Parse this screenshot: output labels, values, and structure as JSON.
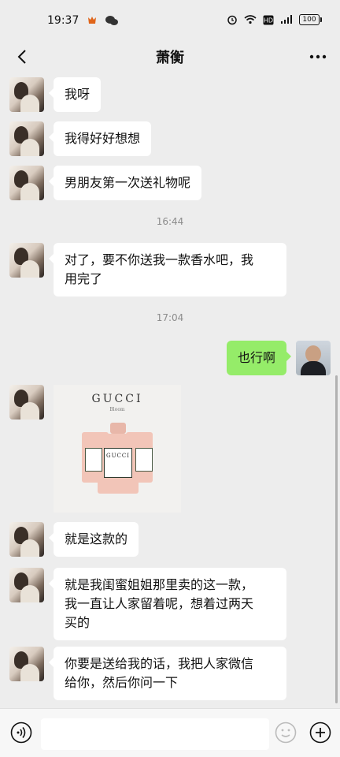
{
  "status_bar": {
    "time": "19:37",
    "network_icons": [
      "hd-icon",
      "4g-icon",
      "wifi-icon"
    ],
    "battery": "100"
  },
  "header": {
    "title": "萧衡"
  },
  "messages": [
    {
      "from": "other",
      "text": "我呀"
    },
    {
      "from": "other",
      "text": "我得好好想想"
    },
    {
      "from": "other",
      "text": "男朋友第一次送礼物呢"
    },
    {
      "type": "time",
      "text": "16:44"
    },
    {
      "from": "other",
      "text_lines": [
        "对了，要不你送我一款香水吧，我",
        "用完了"
      ]
    },
    {
      "type": "time",
      "text": "17:04"
    },
    {
      "from": "me",
      "text": "也行啊"
    },
    {
      "from": "other",
      "type": "image",
      "brand": "GUCCI",
      "sub": "Bloom",
      "label_text": "GUCCI"
    },
    {
      "from": "other",
      "text": "就是这款的"
    },
    {
      "from": "other",
      "text_lines": [
        "就是我闺蜜姐姐那里卖的这一款，",
        "我一直让人家留着呢，想着过两天",
        "买的"
      ]
    },
    {
      "from": "other",
      "text_lines": [
        "你要是送给我的话，我把人家微信",
        "给你，然后你问一下"
      ]
    }
  ],
  "input": {
    "placeholder": "",
    "voice_icon": "voice-icon",
    "emoji_icon": "emoji-icon",
    "add_icon": "add-icon"
  },
  "colors": {
    "incoming_bubble": "#ffffff",
    "outgoing_bubble": "#95ec69",
    "background": "#ededed"
  }
}
